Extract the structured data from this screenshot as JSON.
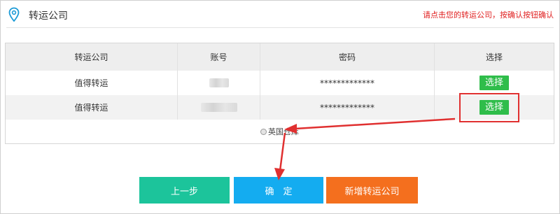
{
  "header": {
    "title": "转运公司",
    "hint": "请点击您的转运公司，按确认按钮确认"
  },
  "table": {
    "columns": [
      "转运公司",
      "账号",
      "密码",
      "选择"
    ],
    "rows": [
      {
        "company": "值得转运",
        "password": "*************",
        "action": "选择"
      },
      {
        "company": "值得转运",
        "password": "*************",
        "action": "选择"
      }
    ],
    "warehouse_option": "英国仓库"
  },
  "buttons": {
    "prev": "上一步",
    "confirm": "确　定",
    "add": "新增转运公司"
  },
  "colors": {
    "select_green": "#2fbd4a",
    "prev_teal": "#1cc49b",
    "confirm_blue": "#14acf0",
    "add_orange": "#f46f1e",
    "annotation_red": "#e03030",
    "hint_red": "#e02020"
  }
}
